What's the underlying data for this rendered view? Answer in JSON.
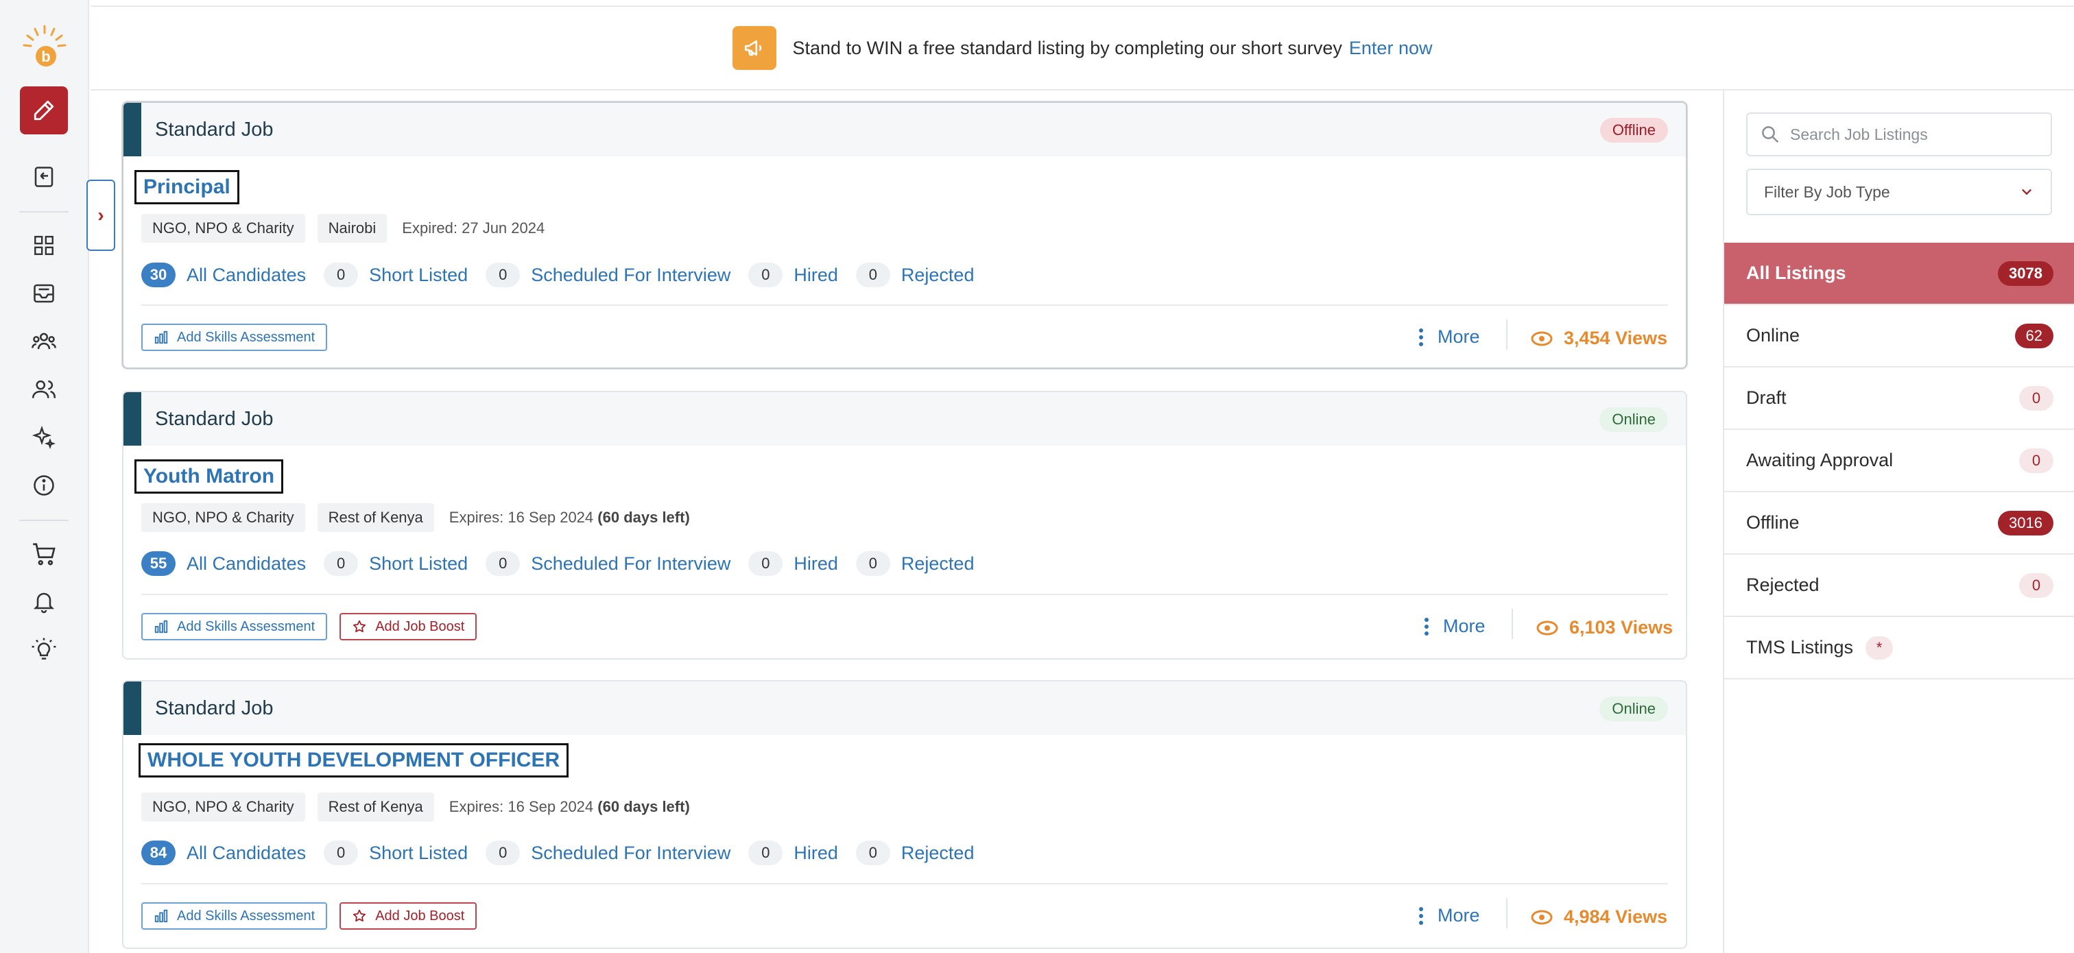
{
  "banner": {
    "text": "Stand to WIN a free standard listing by completing our short survey",
    "link": "Enter now"
  },
  "jobs": [
    {
      "type": "Standard Job",
      "status": "Offline",
      "title": "Principal",
      "tags": [
        "NGO, NPO & Charity",
        "Nairobi"
      ],
      "expiry": "Expired: 27 Jun 2024",
      "expiry_extra": "",
      "stats": {
        "all_count": "30",
        "all_label": "All Candidates",
        "short_count": "0",
        "short_label": "Short Listed",
        "interview_count": "0",
        "interview_label": "Scheduled For Interview",
        "hired_count": "0",
        "hired_label": "Hired",
        "rejected_count": "0",
        "rejected_label": "Rejected"
      },
      "skills_btn": "Add Skills Assessment",
      "boost_btn": "",
      "more": "More",
      "views": "3,454 Views"
    },
    {
      "type": "Standard Job",
      "status": "Online",
      "title": "Youth Matron",
      "tags": [
        "NGO, NPO & Charity",
        "Rest of Kenya"
      ],
      "expiry": "Expires: 16 Sep 2024",
      "expiry_extra": "(60 days left)",
      "stats": {
        "all_count": "55",
        "all_label": "All Candidates",
        "short_count": "0",
        "short_label": "Short Listed",
        "interview_count": "0",
        "interview_label": "Scheduled For Interview",
        "hired_count": "0",
        "hired_label": "Hired",
        "rejected_count": "0",
        "rejected_label": "Rejected"
      },
      "skills_btn": "Add Skills Assessment",
      "boost_btn": "Add Job Boost",
      "more": "More",
      "views": "6,103 Views"
    },
    {
      "type": "Standard Job",
      "status": "Online",
      "title": "WHOLE YOUTH DEVELOPMENT OFFICER",
      "tags": [
        "NGO, NPO & Charity",
        "Rest of Kenya"
      ],
      "expiry": "Expires: 16 Sep 2024",
      "expiry_extra": "(60 days left)",
      "stats": {
        "all_count": "84",
        "all_label": "All Candidates",
        "short_count": "0",
        "short_label": "Short Listed",
        "interview_count": "0",
        "interview_label": "Scheduled For Interview",
        "hired_count": "0",
        "hired_label": "Hired",
        "rejected_count": "0",
        "rejected_label": "Rejected"
      },
      "skills_btn": "Add Skills Assessment",
      "boost_btn": "Add Job Boost",
      "more": "More",
      "views": "4,984 Views"
    }
  ],
  "search": {
    "placeholder": "Search Job Listings"
  },
  "filter": {
    "placeholder": "Filter By Job Type"
  },
  "listings": [
    {
      "label": "All Listings",
      "count": "3078"
    },
    {
      "label": "Online",
      "count": "62"
    },
    {
      "label": "Draft",
      "count": "0"
    },
    {
      "label": "Awaiting Approval",
      "count": "0"
    },
    {
      "label": "Offline",
      "count": "3016"
    },
    {
      "label": "Rejected",
      "count": "0"
    },
    {
      "label": "TMS Listings",
      "count": "*"
    }
  ],
  "icons": {
    "rail": [
      "logo",
      "pencil-icon",
      "job-history-icon",
      "dashboard-grid-icon",
      "inbox-icon",
      "team-icon",
      "users-icon",
      "sparkle-icon",
      "info-icon",
      "cart-icon",
      "bell-icon",
      "lightbulb-icon"
    ]
  },
  "colors": {
    "brand_red": "#b3262e",
    "link_blue": "#2d74b5",
    "views_orange": "#e68a2e",
    "accent_teal": "#1d4f64",
    "active_listing": "#c8616b"
  }
}
